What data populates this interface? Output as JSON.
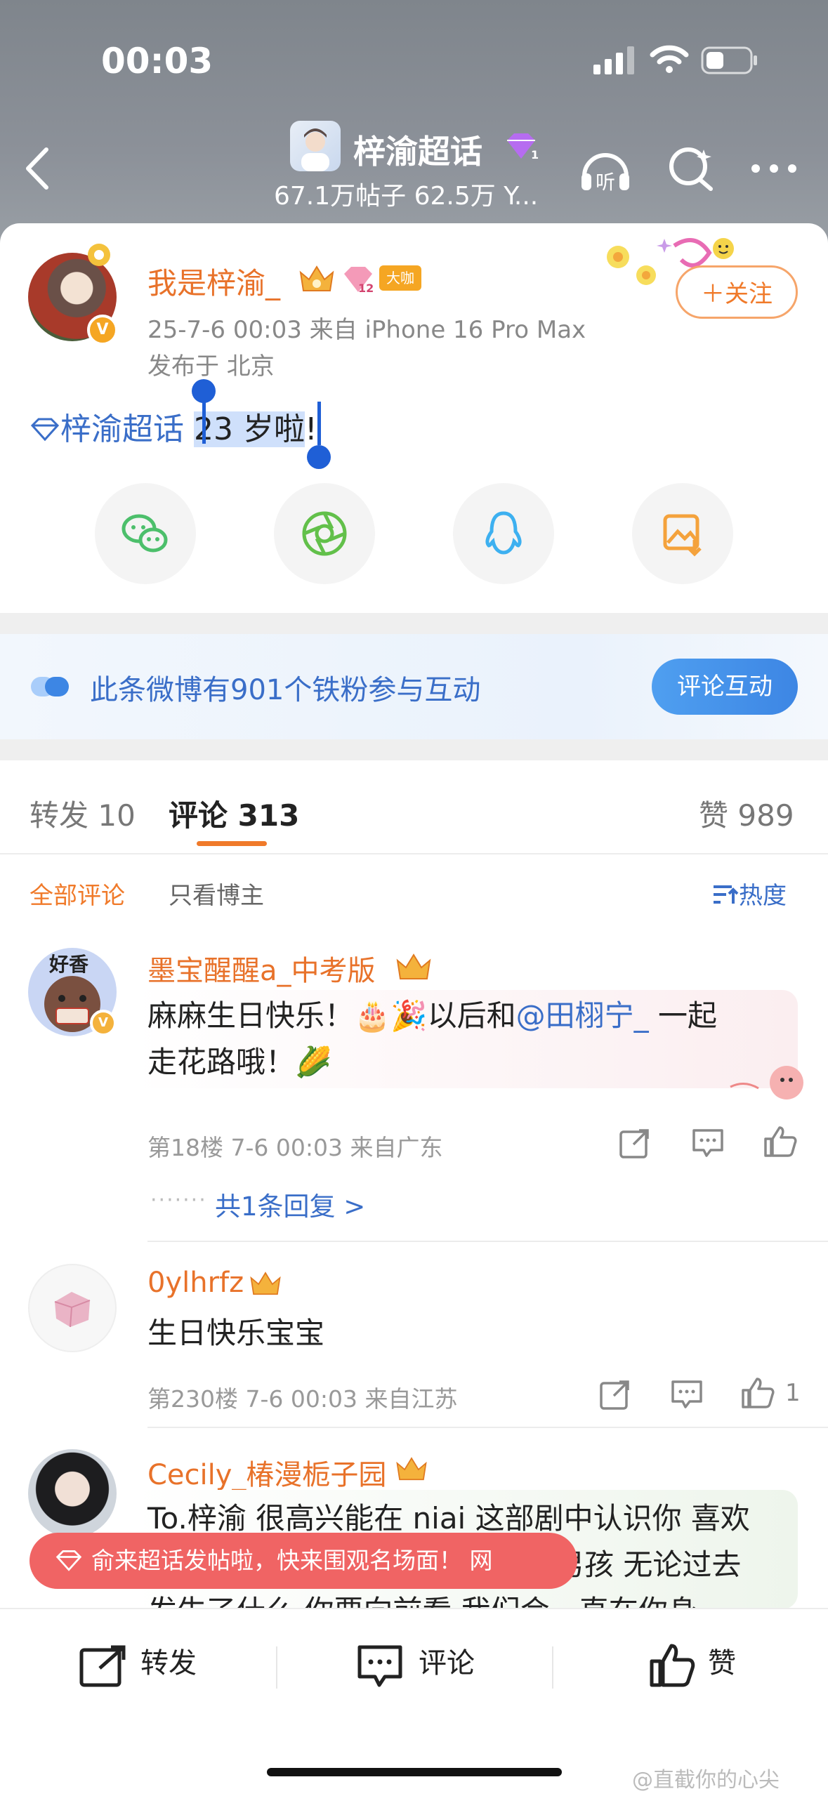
{
  "status": {
    "time": "00:03"
  },
  "topic": {
    "title": "梓渝超话",
    "subtitle": "67.1万帖子 62.5万 Y..."
  },
  "post": {
    "author": "我是梓渝_",
    "level_badge": "大咖",
    "timestamp_source": "25-7-6 00:03  来自 iPhone 16 Pro Max",
    "location": "发布于 北京",
    "follow_label": "关注",
    "topic_tag": "梓渝超话",
    "text_selected": "23 岁啦",
    "text_end": "!"
  },
  "fan_banner": {
    "text": "此条微博有901个铁粉参与互动",
    "button": "评论互动"
  },
  "tabs": [
    {
      "label": "转发",
      "count": "10"
    },
    {
      "label": "评论",
      "count": "313"
    },
    {
      "label": "赞",
      "count": "989"
    }
  ],
  "filters": {
    "all": "全部评论",
    "author_only": "只看博主",
    "sort": "热度"
  },
  "comments": [
    {
      "name": "墨宝醒醒a_中考版",
      "text_line1": "麻麻生日快乐！🎂🎉以后和",
      "mention": "@田栩宁_",
      "text_line1_end": " 一起",
      "text_line2": "走花路哦！🌽",
      "meta": "第18楼  7-6 00:03  来自广东",
      "reply_link": "共1条回复 >",
      "avatar_label": "好香"
    },
    {
      "name": "0ylhrfz",
      "text": "生日快乐宝宝",
      "meta": "第230楼  7-6 00:03  来自江苏",
      "likes": "1"
    },
    {
      "name": "Cecily_椿漫栀子园",
      "text_line1": "To.梓渝 很高兴能在 niai 这部剧中认识你 喜欢",
      "text_line2": "男孩 无论过去",
      "text_line3": "发生了什么 你要向前看 我们会一直在你身"
    }
  ],
  "toast": {
    "text": "俞来超话发帖啦，快来围观名场面！ 网"
  },
  "bottom_bar": {
    "repost": "转发",
    "comment": "评论",
    "like": "赞"
  },
  "watermark": "@直截你的心尖"
}
